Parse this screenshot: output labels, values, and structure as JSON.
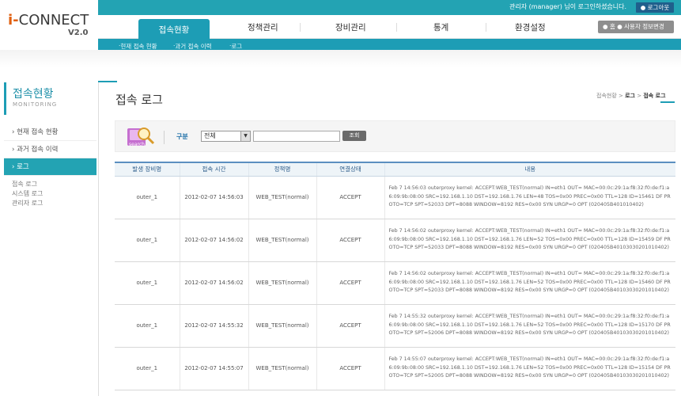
{
  "brand": {
    "logo_prefix": "i-",
    "logo_name": "CONNECT",
    "version": "V2.0"
  },
  "topbar": {
    "greeting": "관리자 (manager) 님이 로그인하셨습니다.",
    "logout_label": "로그아웃"
  },
  "nav": {
    "items": [
      "접속현황",
      "정책관리",
      "장비관리",
      "통계",
      "환경설정"
    ],
    "active_index": 0,
    "home_label": "홈  ● 사용자 정보변경"
  },
  "subnav": [
    "현재 접속 현황",
    "과거 접속 이력",
    "로그"
  ],
  "sidebar": {
    "title": "접속현황",
    "subtitle": "MONITORING",
    "items": [
      "현재 접속 현황",
      "과거 접속 이력",
      "로그"
    ],
    "active_index": 2,
    "sub_items": [
      "접속 로그",
      "시스템 로그",
      "관리자 로그"
    ]
  },
  "page": {
    "title": "접속 로그",
    "breadcrumb": [
      "접속현황",
      "로그",
      "접속 로그"
    ]
  },
  "search": {
    "icon_text": "search",
    "label": "구분",
    "select_value": "전체",
    "input_value": "",
    "button_label": "조회"
  },
  "table": {
    "columns": [
      "발생 장비명",
      "접속 시간",
      "정책명",
      "연결상태",
      "내용"
    ],
    "rows": [
      {
        "device": "outer_1",
        "time": "2012-02-07 14:56:03",
        "policy": "WEB_TEST(normal)",
        "status": "ACCEPT",
        "content": "Feb 7 14:56:03 outerproxy kernel: ACCEPT:WEB_TEST(normal) IN=eth1 OUT= MAC=00:0c:29:1a:f8:32:f0:de:f1:a6:09:9b:08:00 SRC=192.168.1.10 DST=192.168.1.76 LEN=48 TOS=0x00 PREC=0x00 TTL=128 ID=15461 DF PROTO=TCP SPT=52033 DPT=8088 WINDOW=8192 RES=0x00 SYN URGP=0 OPT (020405B401010402)"
      },
      {
        "device": "outer_1",
        "time": "2012-02-07 14:56:02",
        "policy": "WEB_TEST(normal)",
        "status": "ACCEPT",
        "content": "Feb 7 14:56:02 outerproxy kernel: ACCEPT:WEB_TEST(normal) IN=eth1 OUT= MAC=00:0c:29:1a:f8:32:f0:de:f1:a6:09:9b:08:00 SRC=192.168.1.10 DST=192.168.1.76 LEN=52 TOS=0x00 PREC=0x00 TTL=128 ID=15459 DF PROTO=TCP SPT=52033 DPT=8088 WINDOW=8192 RES=0x00 SYN URGP=0 OPT (020405B40103030201010402)"
      },
      {
        "device": "outer_1",
        "time": "2012-02-07 14:56:02",
        "policy": "WEB_TEST(normal)",
        "status": "ACCEPT",
        "content": "Feb 7 14:56:02 outerproxy kernel: ACCEPT:WEB_TEST(normal) IN=eth1 OUT= MAC=00:0c:29:1a:f8:32:f0:de:f1:a6:09:9b:08:00 SRC=192.168.1.10 DST=192.168.1.76 LEN=52 TOS=0x00 PREC=0x00 TTL=128 ID=15460 DF PROTO=TCP SPT=52033 DPT=8088 WINDOW=8192 RES=0x00 SYN URGP=0 OPT (020405B40103030201010402)"
      },
      {
        "device": "outer_1",
        "time": "2012-02-07 14:55:32",
        "policy": "WEB_TEST(normal)",
        "status": "ACCEPT",
        "content": "Feb 7 14:55:32 outerproxy kernel: ACCEPT:WEB_TEST(normal) IN=eth1 OUT= MAC=00:0c:29:1a:f8:32:f0:de:f1:a6:09:9b:08:00 SRC=192.168.1.10 DST=192.168.1.76 LEN=52 TOS=0x00 PREC=0x00 TTL=128 ID=15170 DF PROTO=TCP SPT=52006 DPT=8088 WINDOW=8192 RES=0x00 SYN URGP=0 OPT (020405B40103030201010402)"
      },
      {
        "device": "outer_1",
        "time": "2012-02-07 14:55:07",
        "policy": "WEB_TEST(normal)",
        "status": "ACCEPT",
        "content": "Feb 7 14:55:07 outerproxy kernel: ACCEPT:WEB_TEST(normal) IN=eth1 OUT= MAC=00:0c:29:1a:f8:32:f0:de:f1:a6:09:9b:08:00 SRC=192.168.1.10 DST=192.168.1.76 LEN=52 TOS=0x00 PREC=0x00 TTL=128 ID=15154 DF PROTO=TCP SPT=52005 DPT=8088 WINDOW=8192 RES=0x00 SYN URGP=0 OPT (020405B40103030201010402)"
      }
    ]
  },
  "colors": {
    "accent": "#1d9db5",
    "topbar": "#23a3b3",
    "logo_i": "#e06010",
    "header_border": "#5b8fc0"
  }
}
